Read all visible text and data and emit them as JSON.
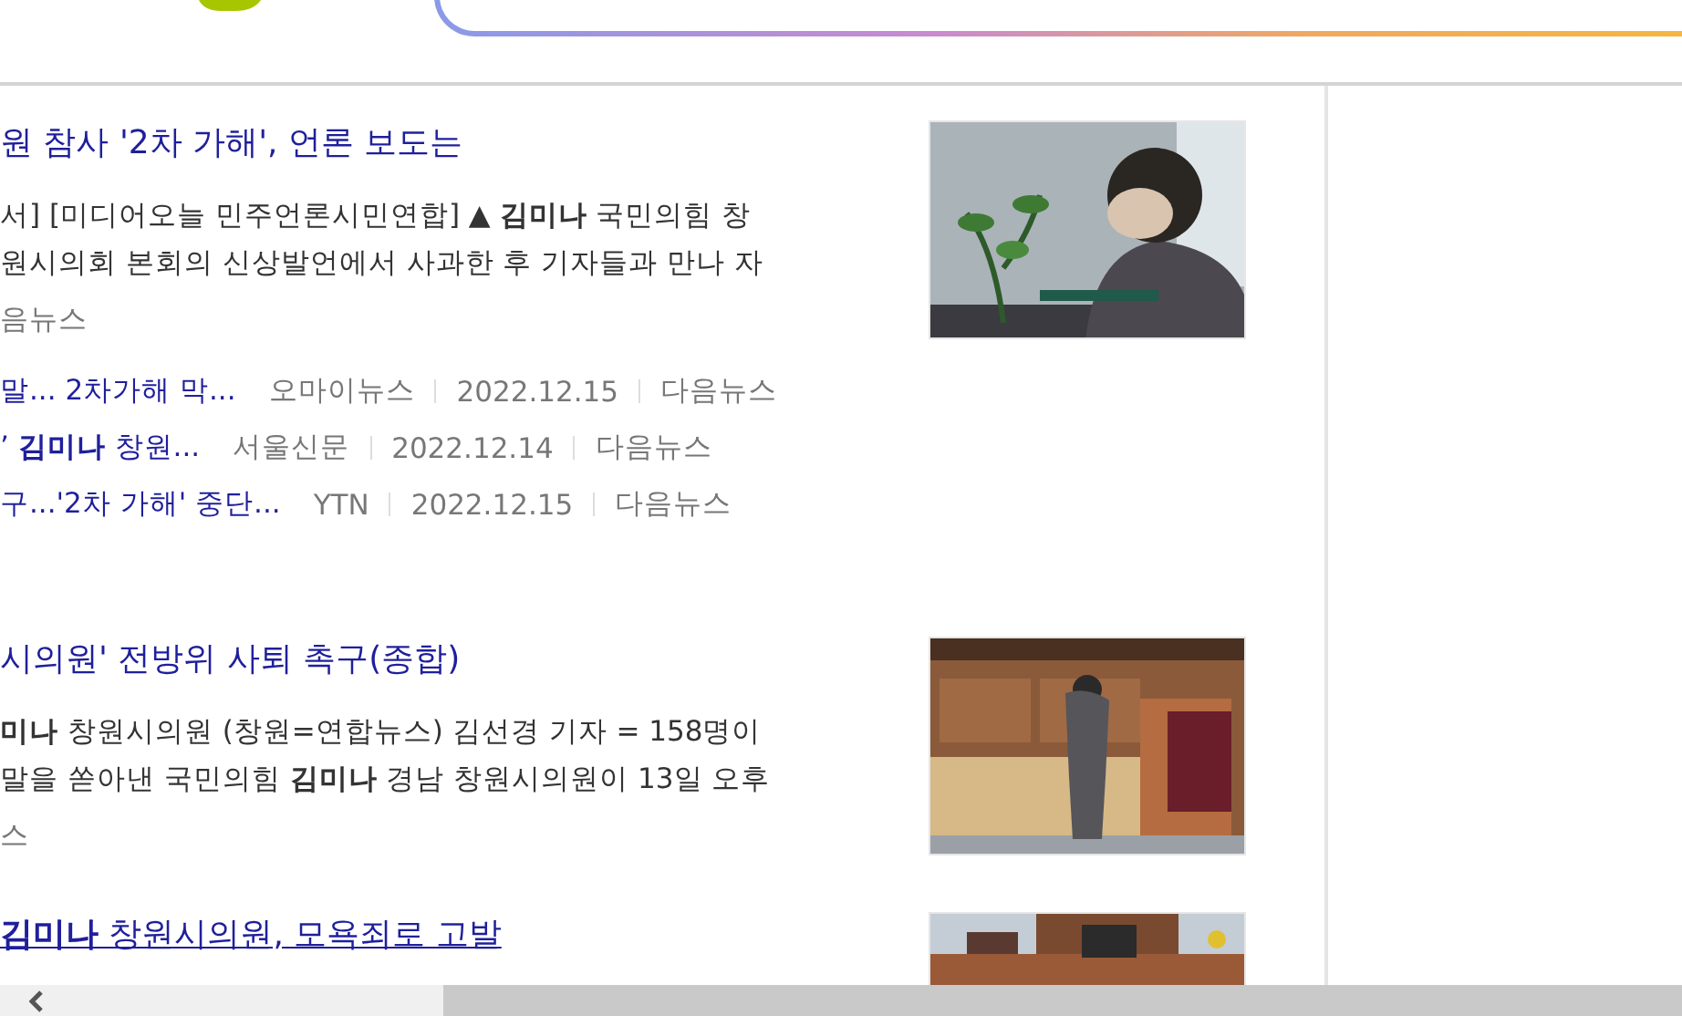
{
  "results": [
    {
      "title": "원 참사 '2차 가해', 언론 보도는",
      "underlined": false,
      "snippet": [
        "서] [미디어오늘 민주언론시민연합] ▲ **김미나** 국민의힘 창",
        "원시의회 본회의 신상발언에서 사과한 후 기자들과 만나 자"
      ],
      "source": "음뉴스",
      "related": [
        {
          "title": "말... 2차가해 막...",
          "press": "오마이뉴스",
          "date": "2022.12.15",
          "portal": "다음뉴스"
        },
        {
          "title": "’ **김미나** 창원...",
          "press": "서울신문",
          "date": "2022.12.14",
          "portal": "다음뉴스"
        },
        {
          "title": "구...'2차 가해' 중단...",
          "press": "YTN",
          "date": "2022.12.15",
          "portal": "다음뉴스"
        }
      ],
      "picture": {
        "kind": "picture"
      }
    },
    {
      "title": "시의원' 전방위 사퇴 촉구(종합)",
      "underlined": false,
      "snippet": [
        "**미나** 창원시의원 (창원=연합뉴스) 김선경 기자 = 158명이",
        "말을 쏟아낸 국민의힘 **김미나** 경남 창원시의원이 13일 오후"
      ],
      "source": "스",
      "picture": {
        "kind": "picture"
      }
    },
    {
      "title": "**김미나** 창원시의원, 모욕죄로 고발",
      "underlined": true,
      "picture": {
        "kind": "picture"
      }
    }
  ]
}
